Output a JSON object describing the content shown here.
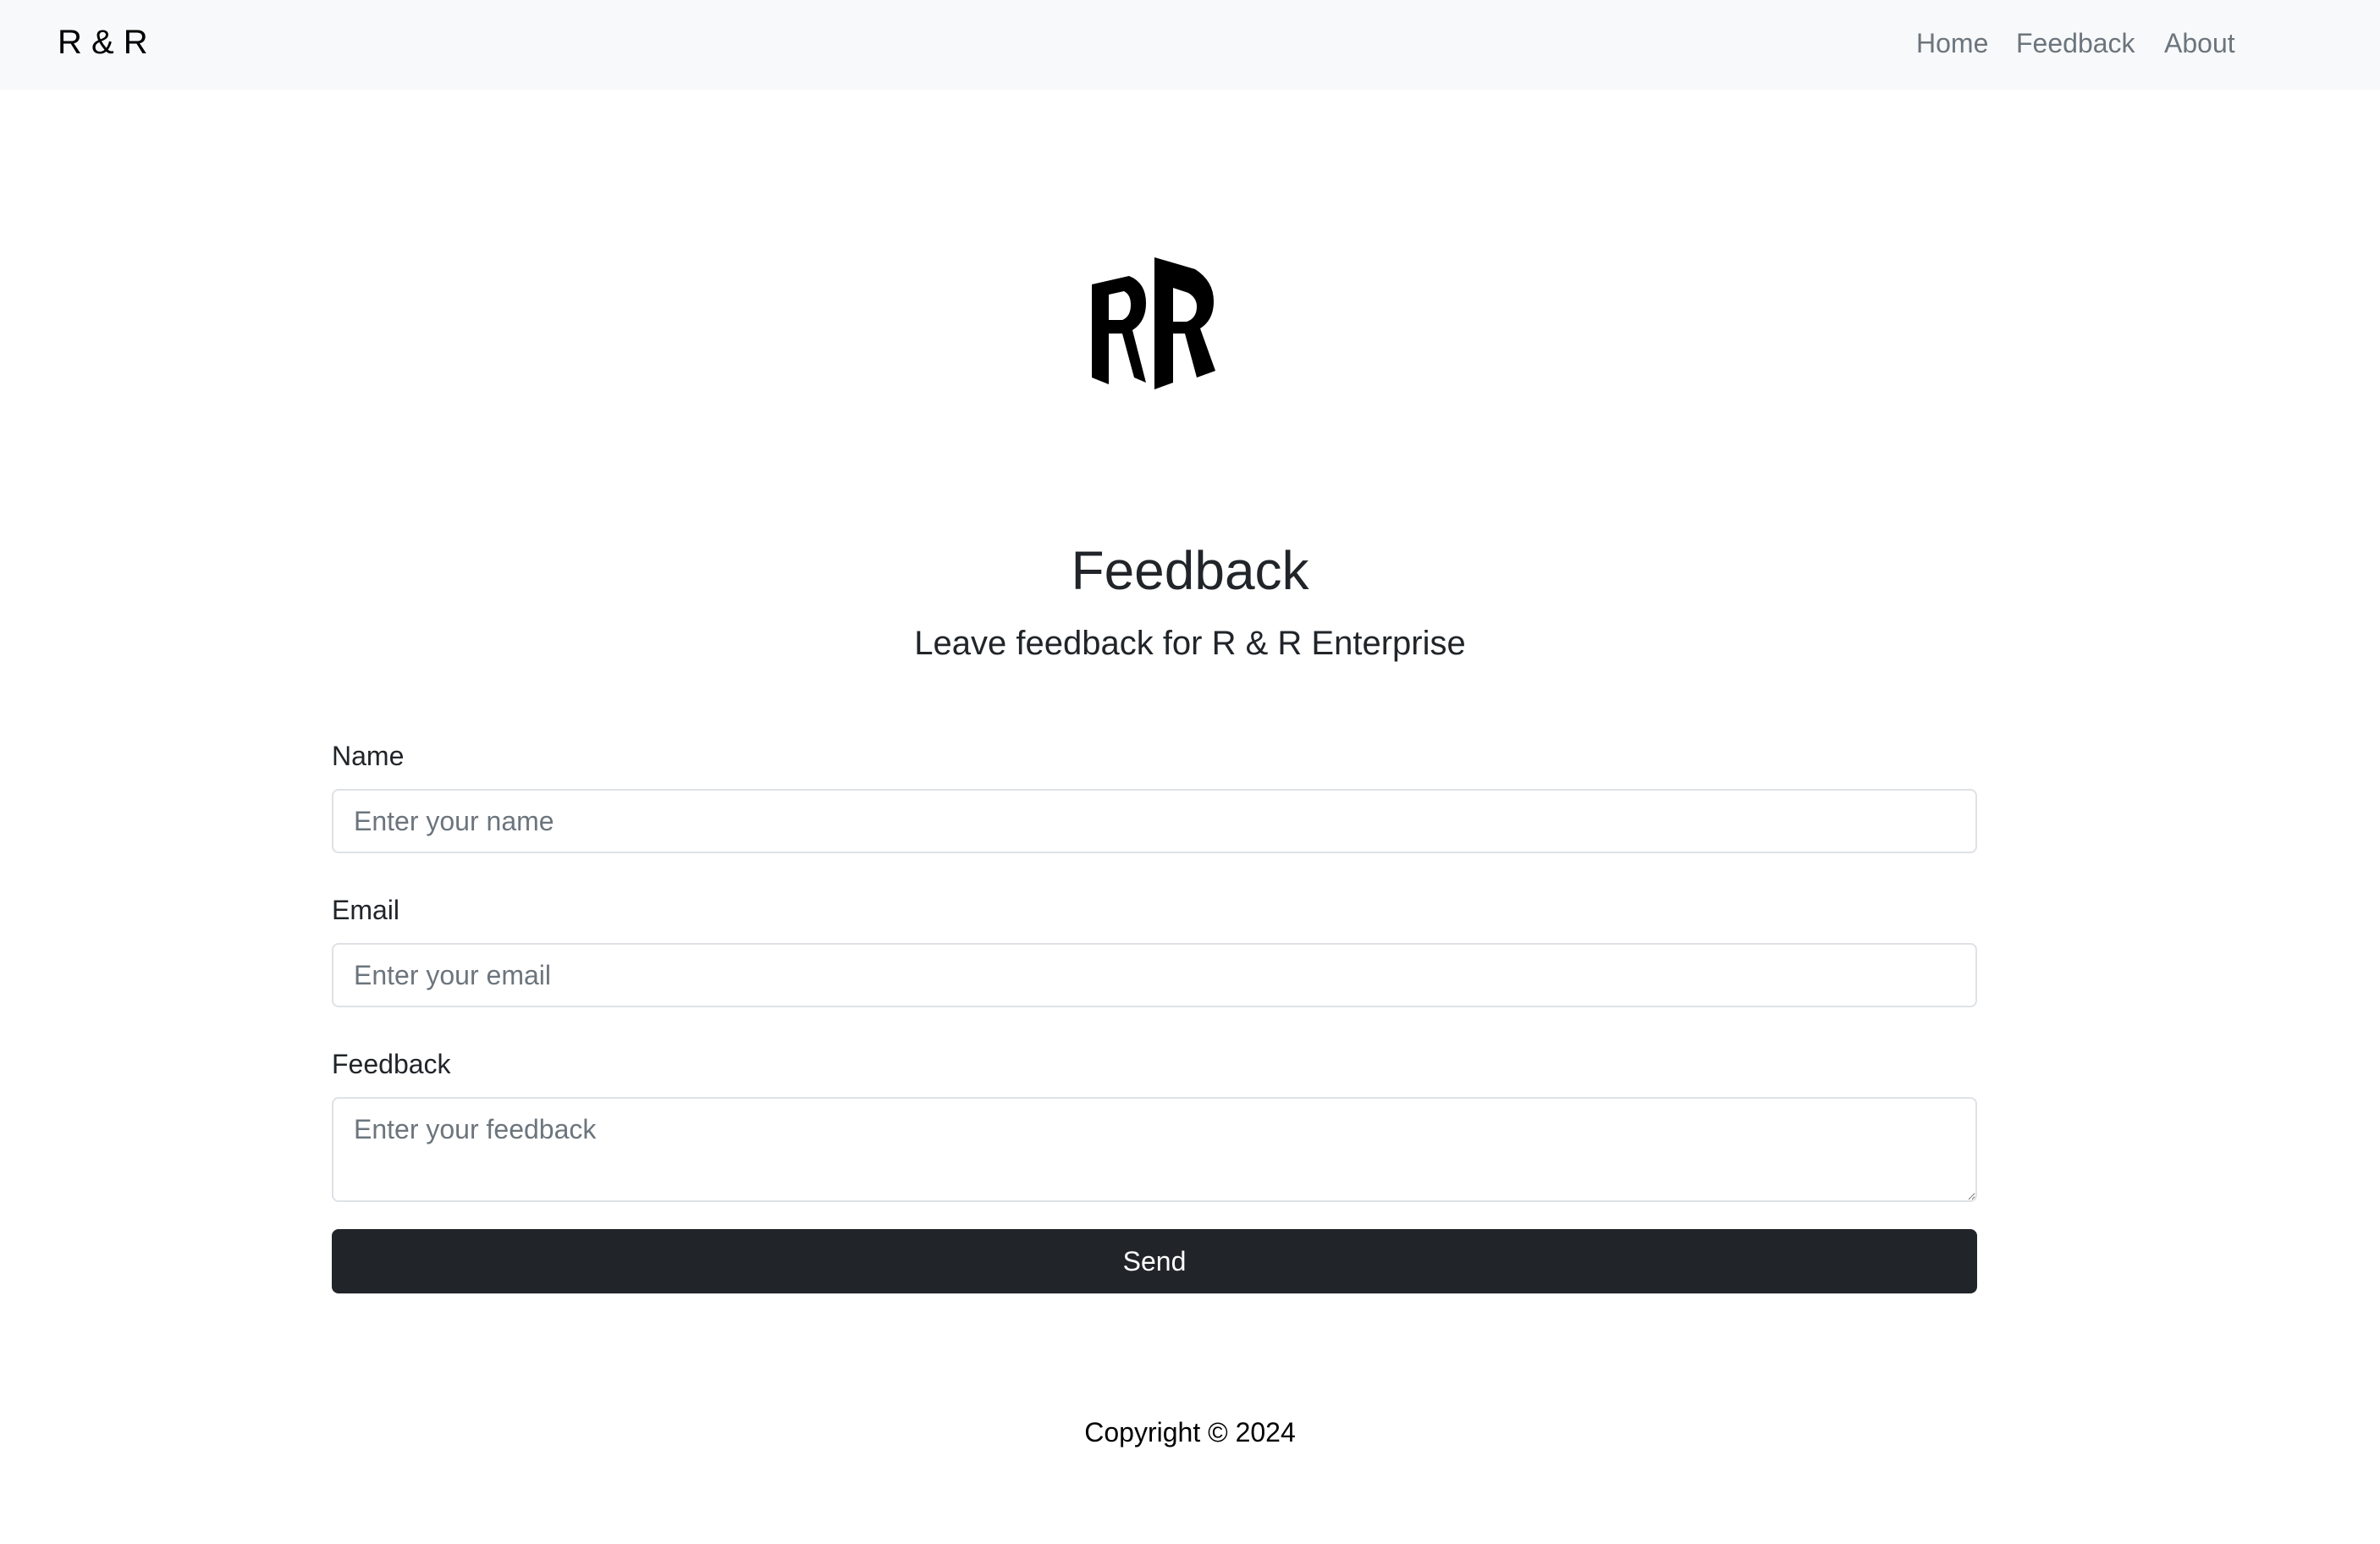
{
  "navbar": {
    "brand": "R & R",
    "links": [
      "Home",
      "Feedback",
      "About"
    ],
    "background": "#f8f9fa"
  },
  "logo": {
    "icon": "rr-monogram-logo"
  },
  "header": {
    "title": "Feedback",
    "subtitle": "Leave feedback for R & R Enterprise"
  },
  "form": {
    "name": {
      "label": "Name",
      "placeholder": "Enter your name",
      "value": ""
    },
    "email": {
      "label": "Email",
      "placeholder": "Enter your email",
      "value": ""
    },
    "feedback": {
      "label": "Feedback",
      "placeholder": "Enter your feedback",
      "value": ""
    },
    "send_label": "Send"
  },
  "footer": {
    "copyright": "Copyright © 2024"
  },
  "colors": {
    "button_bg": "#212529",
    "button_text": "#ffffff",
    "nav_link": "#6c757d",
    "input_border": "#dee2e6"
  }
}
